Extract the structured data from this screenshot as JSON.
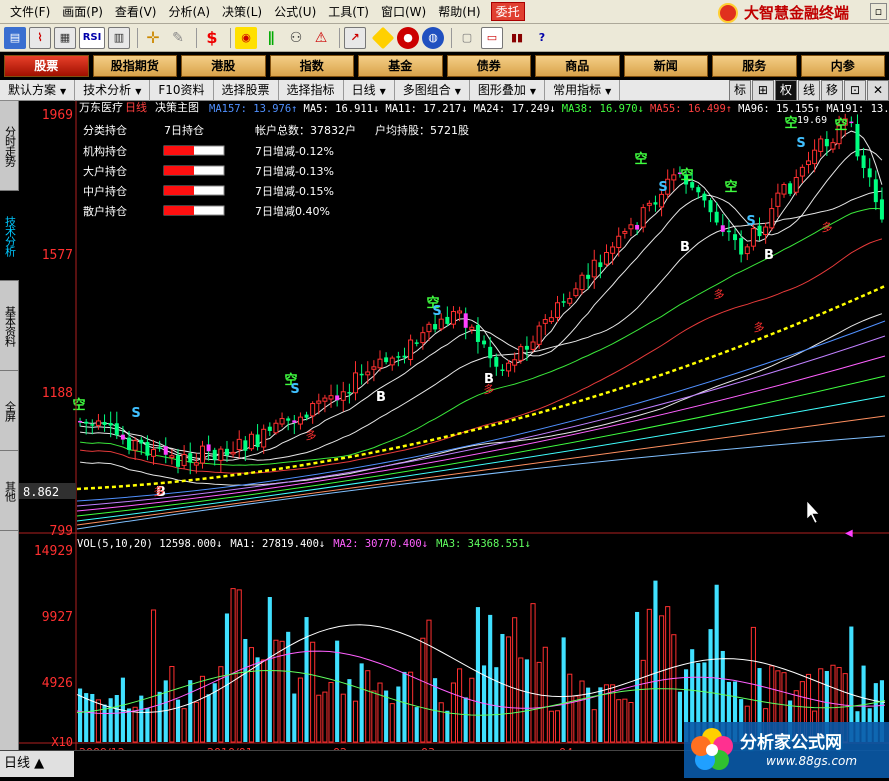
{
  "menubar": {
    "items": [
      "文件(F)",
      "画面(P)",
      "查看(V)",
      "分析(A)",
      "决策(L)",
      "公式(U)",
      "工具(T)",
      "窗口(W)",
      "帮助(H)"
    ],
    "active_item": "委托",
    "brand": "大智慧金融终端"
  },
  "nav": {
    "tabs": [
      "股票",
      "股指期货",
      "港股",
      "指数",
      "基金",
      "债券",
      "商品",
      "新闻",
      "服务",
      "内参"
    ],
    "active": "股票"
  },
  "toolbar2": {
    "items": [
      {
        "label": "默认方案",
        "dropdown": true
      },
      {
        "label": "技术分析",
        "dropdown": true
      },
      {
        "label": "F10资料",
        "dropdown": false
      },
      {
        "label": "选择股票",
        "dropdown": false
      },
      {
        "label": "选择指标",
        "dropdown": false
      },
      {
        "label": "日线",
        "dropdown": true
      },
      {
        "label": "多图组合",
        "dropdown": true
      },
      {
        "label": "图形叠加",
        "dropdown": true
      },
      {
        "label": "常用指标",
        "dropdown": true
      }
    ],
    "right_buttons": [
      "标",
      "⊞",
      "权",
      "线",
      "移",
      "⊡",
      "✕"
    ]
  },
  "sidebar": {
    "tabs": [
      "分时走势",
      "技术分析",
      "基本资料",
      "全屏",
      "其他"
    ],
    "active": "技术分析"
  },
  "chart_header": {
    "stock": "万东医疗",
    "period": "日线",
    "main_label": "决策主图",
    "indicators": [
      {
        "name": "MA157",
        "value": "13.976",
        "arrow": "↑",
        "color": "#5090ff"
      },
      {
        "name": "MA5",
        "value": "16.911",
        "arrow": "↓",
        "color": "#ffffff"
      },
      {
        "name": "MA11",
        "value": "17.217",
        "arrow": "↓",
        "color": "#ffffff"
      },
      {
        "name": "MA24",
        "value": "17.249",
        "arrow": "↓",
        "color": "#ffffff"
      },
      {
        "name": "MA38",
        "value": "16.970",
        "arrow": "↓",
        "color": "#40ff40"
      },
      {
        "name": "MA55",
        "value": "16.499",
        "arrow": "↑",
        "color": "#ff4040"
      },
      {
        "name": "MA96",
        "value": "15.155",
        "arrow": "↑",
        "color": "#ffffff"
      },
      {
        "name": "MA191",
        "value": "13.",
        "arrow": "",
        "color": "#ffffff"
      }
    ]
  },
  "holdings": {
    "col1": "分类持仓",
    "col2": "7日持仓",
    "total_label": "帐户总数：",
    "total_value": "37832户",
    "avg_label": "户均持股：",
    "avg_value": "5721股",
    "rows": [
      {
        "label": "机构持仓",
        "fill": 0.5,
        "change": "7日增减-0.12%"
      },
      {
        "label": "大户持仓",
        "fill": 0.5,
        "change": "7日增减-0.13%"
      },
      {
        "label": "中户持仓",
        "fill": 0.5,
        "change": "7日增减-0.15%"
      },
      {
        "label": "散户持仓",
        "fill": 0.5,
        "change": "7日增减0.40%"
      }
    ]
  },
  "price_axis": {
    "labels": [
      "1969",
      "1577",
      "1188",
      "799"
    ],
    "current": "8.862",
    "high_note": "19.69"
  },
  "vol_header": {
    "name": "VOL(5,10,20)",
    "value": "12598.000",
    "arrow": "↓",
    "ma": [
      {
        "name": "MA1",
        "value": "27819.400",
        "arrow": "↓",
        "color": "#ffffff"
      },
      {
        "name": "MA2",
        "value": "30770.400",
        "arrow": "↓",
        "color": "#ff60ff"
      },
      {
        "name": "MA3",
        "value": "34368.551",
        "arrow": "↓",
        "color": "#60ff60"
      }
    ]
  },
  "vol_axis": {
    "labels": [
      "14929",
      "9927",
      "4926",
      "X10"
    ]
  },
  "date_axis": {
    "labels": [
      "2009/12",
      "2010/01",
      "02",
      "03",
      "04"
    ]
  },
  "status": {
    "period": "日线"
  },
  "watermark": {
    "text": "分析家公式网",
    "url": "www.88gs.com"
  },
  "colors": {
    "up": "#ff3030",
    "down": "#00ffff",
    "accent": "#e04030",
    "ma_yellow": "#ffff00"
  }
}
